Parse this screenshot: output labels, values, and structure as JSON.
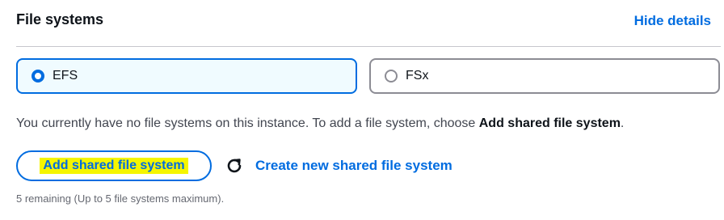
{
  "header": {
    "title": "File systems",
    "hide_details_label": "Hide details"
  },
  "options": [
    {
      "label": "EFS",
      "selected": true
    },
    {
      "label": "FSx",
      "selected": false
    }
  ],
  "description": {
    "prefix": "You currently have no file systems on this instance. To add a file system, choose ",
    "emphasis": "Add shared file system",
    "suffix": "."
  },
  "actions": {
    "add_button_label": "Add shared file system",
    "refresh_icon": "refresh-icon",
    "create_link_label": "Create new shared file system"
  },
  "footer": {
    "remaining_text": "5 remaining (Up to 5 file systems maximum)."
  },
  "colors": {
    "accent": "#006ce0",
    "highlight": "#f5f500",
    "selected_tile_bg": "#f0fbff"
  }
}
